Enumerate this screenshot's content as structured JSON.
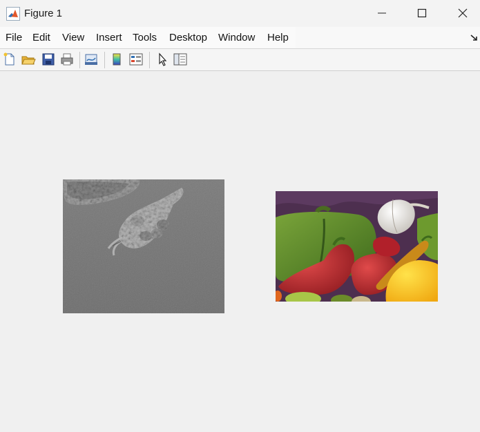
{
  "window": {
    "title": "Figure 1",
    "icon": "matlab-logo-icon",
    "controls": [
      "minimize-icon",
      "maximize-icon",
      "close-icon"
    ]
  },
  "menu": {
    "items": [
      "File",
      "Edit",
      "View",
      "Insert",
      "Tools",
      "Desktop",
      "Window",
      "Help"
    ]
  },
  "toolbar": {
    "buttons": [
      "new-figure-icon",
      "open-file-icon",
      "save-icon",
      "print-icon",
      "link-plot-icon",
      "insert-colorbar-icon",
      "insert-legend-icon",
      "edit-plot-pointer-icon",
      "property-inspector-icon"
    ]
  },
  "figure": {
    "background": "#f0f0f0",
    "images": [
      {
        "subject": "grayscale microscopy image of cells",
        "colormap": "gray"
      },
      {
        "subject": "color photo of peppers",
        "colormap": "rgb"
      }
    ]
  }
}
